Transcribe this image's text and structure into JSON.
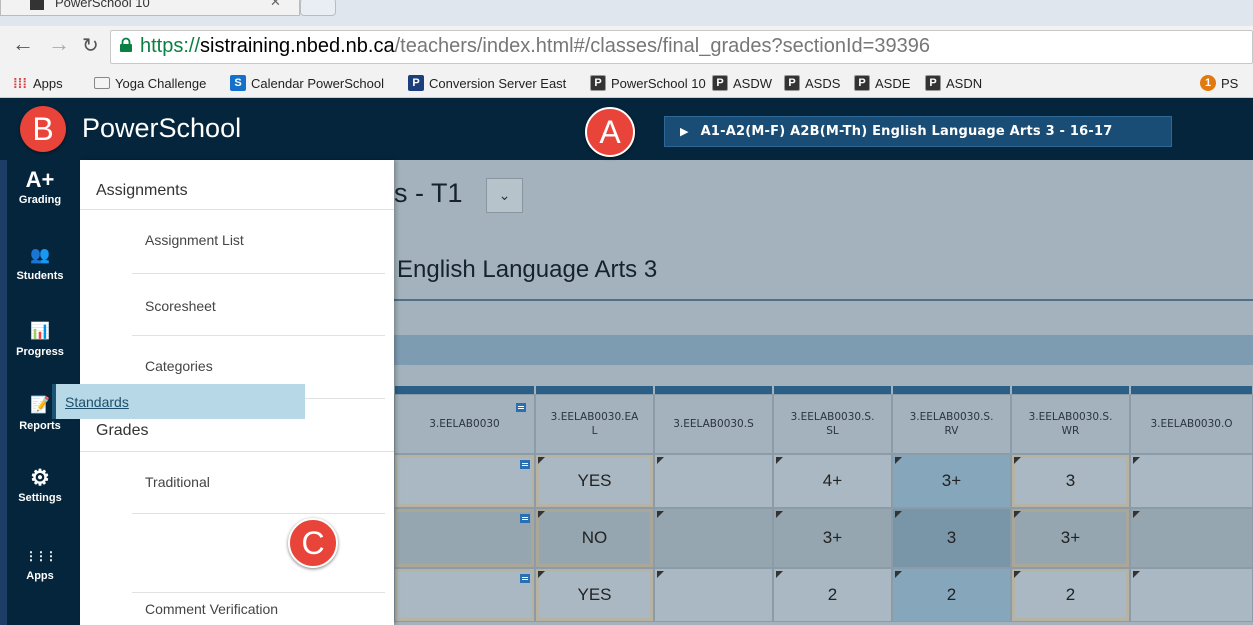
{
  "browser": {
    "tab_title": "PowerSchool 10",
    "url_scheme": "https://",
    "url_host": "sistraining.nbed.nb.ca",
    "url_path": "/teachers/index.html#/classes/final_grades?sectionId=39396",
    "bookmarks": [
      {
        "label": "Apps",
        "icon": "apps-grid-icon"
      },
      {
        "label": "Yoga Challenge",
        "icon": "folder-icon"
      },
      {
        "label": "Calendar PowerSchool",
        "icon": "sharepoint-icon"
      },
      {
        "label": "Conversion Server East",
        "icon": "powerschool-p-icon"
      },
      {
        "label": "PowerSchool 10",
        "icon": "powerschool-p-icon"
      },
      {
        "label": "ASDW",
        "icon": "powerschool-p-icon"
      },
      {
        "label": "ASDS",
        "icon": "powerschool-p-icon"
      },
      {
        "label": "ASDE",
        "icon": "powerschool-p-icon"
      },
      {
        "label": "ASDN",
        "icon": "powerschool-p-icon"
      },
      {
        "label": "PS",
        "icon": "orange-circle-icon"
      }
    ]
  },
  "header": {
    "brand": "PowerSchool",
    "section": "A1-A2(M-F) A2B(M-Th) English Language Arts 3 - 16-17"
  },
  "callouts": {
    "a": "A",
    "b": "B",
    "c": "C"
  },
  "nav": [
    {
      "label": "Grading",
      "glyph": "A+"
    },
    {
      "label": "Students",
      "glyph": "👥"
    },
    {
      "label": "Progress",
      "glyph": "📊"
    },
    {
      "label": "Reports",
      "glyph": "📝"
    },
    {
      "label": "Settings",
      "glyph": "⚙"
    },
    {
      "label": "Apps",
      "glyph": "⋮⋮⋮"
    }
  ],
  "page": {
    "term_title": "s - T1",
    "term_dropdown": "⌄",
    "class_title": "English Language Arts 3"
  },
  "menu": {
    "assignments_header": "Assignments",
    "assignment_list": "Assignment List",
    "scoresheet": "Scoresheet",
    "categories": "Categories",
    "grades_header": "Grades",
    "traditional": "Traditional",
    "standards": "Standards",
    "comment_verification": "Comment Verification"
  },
  "grid": {
    "columns": [
      "3.EELAB0030",
      "3.EELAB0030.EAL",
      "3.EELAB0030.S",
      "3.EELAB0030.S.SL",
      "3.EELAB0030.S.RV",
      "3.EELAB0030.S.WR",
      "3.EELAB0030.O"
    ],
    "column_lines": [
      [
        "3.EELAB0030"
      ],
      [
        "3.EELAB0030.EA",
        "L"
      ],
      [
        "3.EELAB0030.S"
      ],
      [
        "3.EELAB0030.S.",
        "SL"
      ],
      [
        "3.EELAB0030.S.",
        "RV"
      ],
      [
        "3.EELAB0030.S.",
        "WR"
      ],
      [
        "3.EELAB0030.O"
      ]
    ],
    "rows": [
      [
        "",
        "YES",
        "",
        "4+",
        "3+",
        "3",
        ""
      ],
      [
        "",
        "NO",
        "",
        "3+",
        "3",
        "3+",
        ""
      ],
      [
        "",
        "YES",
        "",
        "2",
        "2",
        "2",
        ""
      ]
    ]
  }
}
